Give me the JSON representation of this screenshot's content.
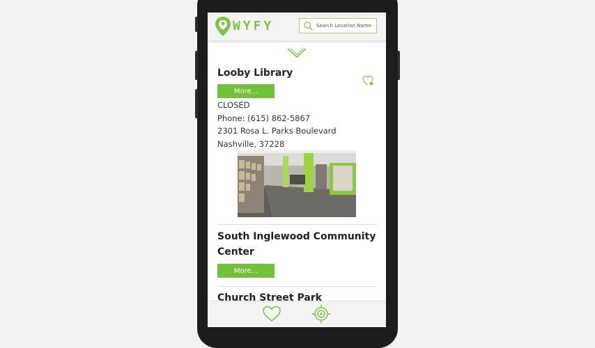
{
  "app": {
    "logo_text": "WYFY"
  },
  "search": {
    "placeholder": "Search Location Name"
  },
  "locations": [
    {
      "name": "Looby Library",
      "more_label": "More...",
      "status": "CLOSED",
      "phone": "Phone: (615) 862-5867",
      "address_line1": "2301 Rosa L. Parks Boulevard",
      "address_line2": "Nashville, 37228"
    },
    {
      "name_line1": "South Inglewood Community",
      "name_line2": "Center",
      "more_label": "More..."
    },
    {
      "name": "Church Street Park"
    }
  ],
  "colors": {
    "accent": "#74c03a",
    "logo": "#7fc24a"
  },
  "icons": [
    "location-pin-icon",
    "search-icon",
    "chevron-down-icon",
    "favorite-heart-icon",
    "heart-icon",
    "locate-target-icon"
  ]
}
